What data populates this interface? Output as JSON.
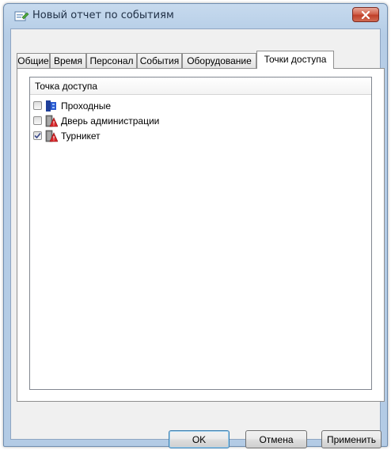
{
  "window": {
    "title": "Новый отчет по событиям",
    "icons": {
      "app": "report-icon",
      "close": "close-icon"
    }
  },
  "tabs": [
    {
      "label": "Общие",
      "active": false
    },
    {
      "label": "Время",
      "active": false
    },
    {
      "label": "Персонал",
      "active": false
    },
    {
      "label": "События",
      "active": false
    },
    {
      "label": "Оборудование",
      "active": false
    },
    {
      "label": "Точки доступа",
      "active": true
    }
  ],
  "access_points": {
    "column_header": "Точка доступа",
    "items": [
      {
        "label": "Проходные",
        "checked": false,
        "icon": "group-icon"
      },
      {
        "label": "Дверь администрации",
        "checked": false,
        "icon": "door-alarm-icon"
      },
      {
        "label": "Турникет",
        "checked": true,
        "icon": "door-alarm-icon"
      }
    ]
  },
  "buttons": {
    "ok": "OK",
    "cancel": "Отмена",
    "apply": "Применить"
  },
  "colors": {
    "titlebar": "#b9d0e8",
    "close_button": "#c7432e",
    "default_button_border": "#3c7fb1"
  }
}
